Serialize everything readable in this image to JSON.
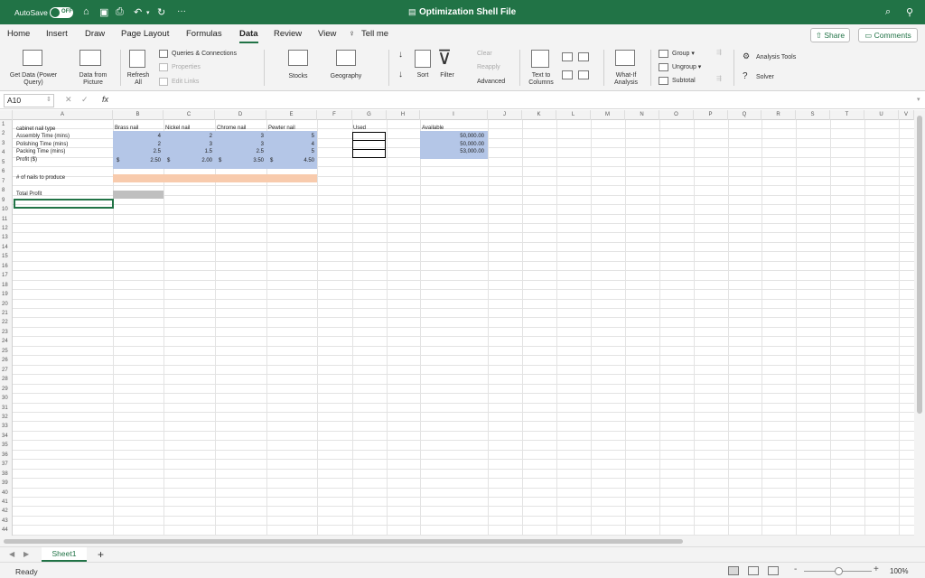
{
  "title_bar": {
    "autosave_label": "AutoSave",
    "autosave_state": "OFF",
    "document_title": "Optimization Shell File",
    "more_label": "···"
  },
  "tabs": [
    "Home",
    "Insert",
    "Draw",
    "Page Layout",
    "Formulas",
    "Data",
    "Review",
    "View",
    "Tell me"
  ],
  "active_tab": "Data",
  "share_label": "Share",
  "comments_label": "Comments",
  "ribbon": {
    "get_data": [
      "Get Data (Power",
      "Query)"
    ],
    "data_from_picture": [
      "Data from",
      "Picture"
    ],
    "refresh_all": [
      "Refresh",
      "All"
    ],
    "queries_connections": "Queries & Connections",
    "properties": "Properties",
    "edit_links": "Edit Links",
    "stocks": "Stocks",
    "geography": "Geography",
    "sort": "Sort",
    "filter": "Filter",
    "clear": "Clear",
    "reapply": "Reapply",
    "advanced": "Advanced",
    "text_to_columns": [
      "Text to",
      "Columns"
    ],
    "what_if": [
      "What-If",
      "Analysis"
    ],
    "group": "Group",
    "ungroup": "Ungroup",
    "subtotal": "Subtotal",
    "analysis_tools": "Analysis Tools",
    "solver": "Solver"
  },
  "formula_bar": {
    "name_box": "A10",
    "fx": "fx",
    "formula": ""
  },
  "columns": [
    "A",
    "B",
    "C",
    "D",
    "E",
    "F",
    "G",
    "H",
    "I",
    "J",
    "K",
    "L",
    "M",
    "N",
    "O",
    "P",
    "Q",
    "R",
    "S",
    "T",
    "U",
    "V"
  ],
  "rows": [
    "1",
    "2",
    "3",
    "4",
    "5",
    "6",
    "7",
    "8",
    "9",
    "10",
    "11",
    "12",
    "13",
    "14",
    "15",
    "16",
    "17",
    "18",
    "19",
    "20",
    "21",
    "22",
    "23",
    "24",
    "25",
    "26",
    "27",
    "28",
    "29",
    "30",
    "31",
    "32",
    "33",
    "34",
    "35",
    "36",
    "37",
    "38",
    "39",
    "40",
    "41",
    "42",
    "43",
    "44"
  ],
  "sheet": {
    "a1": "cabinet nail type",
    "a2": "Assembly Time (mins)",
    "a3": "Polishing Time (mins)",
    "a4": "Packing Time (mins)",
    "a5": "Profit ($)",
    "a7": "# of nails to produce",
    "a9": "Total Profit",
    "b1": "Brass nail",
    "c1": "Nickel nail",
    "d1": "Chrome nail",
    "e1": "Pewter nail",
    "g1": "Used",
    "i1": "Available",
    "b2": "4",
    "b3": "2",
    "b4": "2.5",
    "b5": "2.50",
    "c2": "2",
    "c3": "3",
    "c4": "1.5",
    "c5": "2.00",
    "d2": "3",
    "d3": "3",
    "d4": "2.5",
    "d5": "3.50",
    "e2": "5",
    "e3": "4",
    "e4": "5",
    "e5": "4.50",
    "i2": "50,000.00",
    "i3": "50,000.00",
    "i4": "53,000.00",
    "currency_symbol": "$"
  },
  "sheet_tab": "Sheet1",
  "add_sheet": "+",
  "status": "Ready",
  "zoom": "100%",
  "colors": {
    "excel_green": "#217346",
    "blue_fill": "#b4c6e7",
    "orange_fill": "#f8cbad",
    "gray_fill": "#bfbfbf"
  }
}
